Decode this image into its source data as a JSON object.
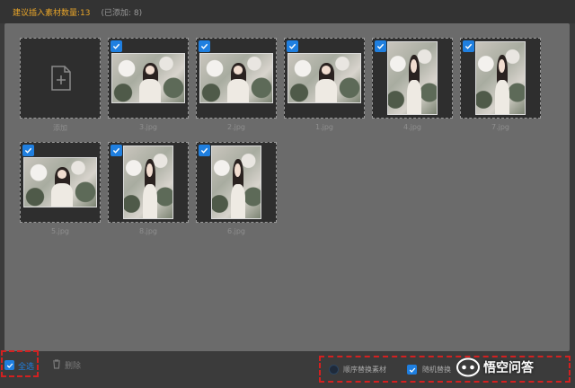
{
  "header": {
    "suggest_label": "建议插入素材数量:13",
    "added_label": "(已添加: 8)"
  },
  "tiles": {
    "add_label": "添加",
    "items": [
      {
        "name": "3.jpg",
        "orient": "land",
        "checked": true
      },
      {
        "name": "2.jpg",
        "orient": "land",
        "checked": true
      },
      {
        "name": "1.jpg",
        "orient": "land",
        "checked": true
      },
      {
        "name": "4.jpg",
        "orient": "port",
        "checked": true
      },
      {
        "name": "7.jpg",
        "orient": "port",
        "checked": true
      },
      {
        "name": "5.jpg",
        "orient": "land",
        "checked": true
      },
      {
        "name": "8.jpg",
        "orient": "port",
        "checked": true
      },
      {
        "name": "6.jpg",
        "orient": "port",
        "checked": true
      }
    ]
  },
  "footer": {
    "select_all_label": "全选",
    "select_all_checked": true,
    "delete_label": "删除",
    "sequential_label": "顺序替换素材",
    "sequential_selected": false,
    "random_label": "随机替换",
    "random_selected": true
  },
  "watermark": {
    "text": "悟空问答"
  },
  "colors": {
    "accent": "#1f7fe0",
    "header_text": "#e8a52a",
    "highlight_border": "#d42020"
  }
}
